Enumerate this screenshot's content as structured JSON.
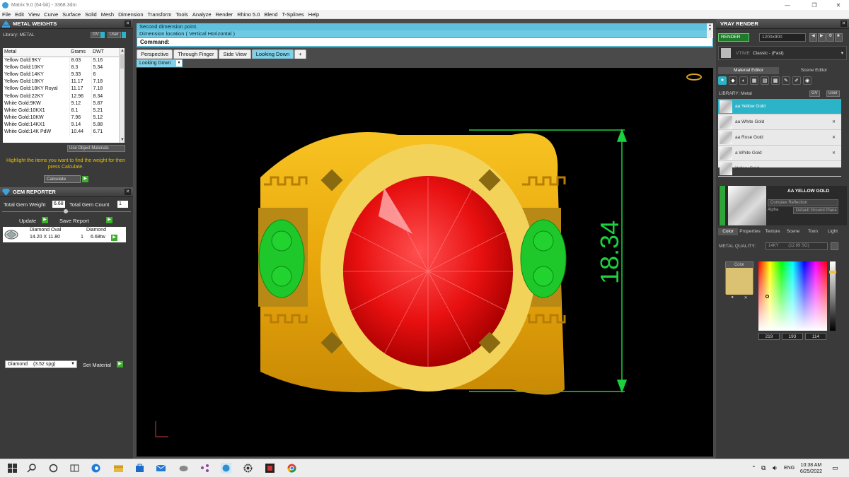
{
  "window": {
    "title": "Matrix 9.0 (64-bit) - 3368.3dm"
  },
  "menu": [
    "File",
    "Edit",
    "View",
    "Curve",
    "Surface",
    "Solid",
    "Mesh",
    "Dimension",
    "Transform",
    "Tools",
    "Analyze",
    "Render",
    "Rhino 5.0",
    "Blend",
    "T-Splines",
    "Help"
  ],
  "metal_weights": {
    "title": "METAL WEIGHTS",
    "library_label": "Library: METAL",
    "btn_gv": "GV",
    "btn_user": "User",
    "columns": [
      "Metal",
      "Grams",
      "DWT"
    ],
    "rows": [
      [
        "Yellow Gold:9KY",
        "8.03",
        "5.16"
      ],
      [
        "Yellow Gold:10KY",
        "8.3",
        "5.34"
      ],
      [
        "Yellow Gold:14KY",
        "9.33",
        "6"
      ],
      [
        "Yellow Gold:18KY",
        "11.17",
        "7.18"
      ],
      [
        "Yellow Gold:18KY Royal",
        "11.17",
        "7.18"
      ],
      [
        "Yellow Gold:22KY",
        "12.96",
        "8.34"
      ],
      [
        "White Gold:9KW",
        "9.12",
        "5.87"
      ],
      [
        "White Gold:10KX1",
        "8.1",
        "5.21"
      ],
      [
        "White Gold:10KW",
        "7.96",
        "5.12"
      ],
      [
        "White Gold:14KX1",
        "9.14",
        "5.88"
      ],
      [
        "White Gold:14K PdW",
        "10.44",
        "6.71"
      ]
    ],
    "use_object_materials": "Use Object Materials",
    "hint": "Highlight the items you want to find the weight for then press Calculate.",
    "calculate": "Calculate"
  },
  "gem_reporter": {
    "title": "GEM REPORTER",
    "total_weight_label": "Total Gem Weight",
    "total_weight_value": "6.68",
    "total_count_label": "Total Gem Count",
    "total_count_value": "1",
    "update": "Update",
    "save_report": "Save Report",
    "gem": {
      "name": "Diamond Oval",
      "size": "14.20 X 11.80",
      "type": "Diamond",
      "count": "1",
      "weight": "6.68tw"
    },
    "material_select": "Diamond",
    "material_sg": "(3.52 spg)",
    "set_material": "Set Material"
  },
  "command": {
    "line1": "Second dimension point.",
    "line2": "Dimension location ( Vertical  Horizontal )",
    "prompt": "Command:"
  },
  "view_tabs": [
    "Perspective",
    "Through Finger",
    "Side View",
    "Looking Down"
  ],
  "active_view": "Looking Down",
  "viewport": {
    "dimension_value": "18.34"
  },
  "vray": {
    "title": "VRAY RENDER",
    "render": "RENDER",
    "resolution": "1200x900",
    "preset_tag": "VTIME",
    "preset": "Classic - (Fast)",
    "tabs": [
      "Material Editor",
      "Scene Editor"
    ],
    "library_label": "LIBRARY: Metal",
    "materials": [
      "aa Yellow Gold",
      "aa White Gold",
      "aa Rose Gold",
      "a White Gold",
      "Yellow Gold"
    ],
    "selected_material": "AA YELLOW GOLD",
    "reflection": "Complex Reflection",
    "alpha": "Alpha",
    "ground_plane": "Default Ground Plane",
    "subtabs": [
      "Color",
      "Properties",
      "Texture",
      "Scene",
      "Toon",
      "Light"
    ],
    "metal_quality_label": "METAL QUALITY:",
    "metal_quality_value": "14KY",
    "metal_quality_sg": "(12.89 SG)",
    "color_label": "Color",
    "rgb": [
      "219",
      "193",
      "114"
    ],
    "swatch_color": "#dbc172"
  },
  "taskbar": {
    "lang": "ENG",
    "time": "10:38 AM",
    "date": "6/25/2022"
  }
}
